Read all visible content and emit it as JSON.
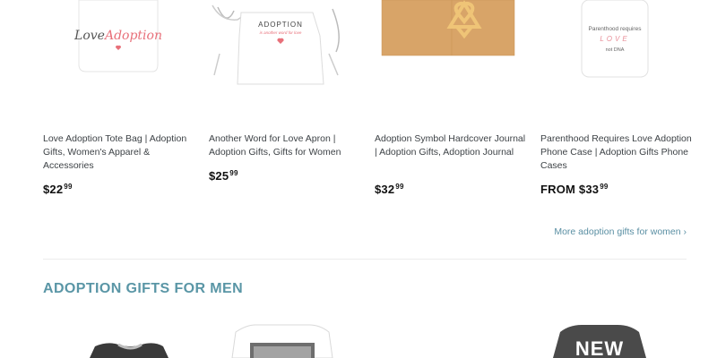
{
  "products": [
    {
      "title": "Love Adoption Tote Bag | Adoption Gifts, Women's Apparel & Accessories",
      "price_prefix": "",
      "price_main": "$22",
      "price_cents": "99",
      "image_text_1": "Love",
      "image_text_2": "Adoption"
    },
    {
      "title": "Another Word for Love Apron | Adoption Gifts, Gifts for Women",
      "price_prefix": "",
      "price_main": "$25",
      "price_cents": "99",
      "image_text_1": "ADOPTION",
      "image_text_2": "is another word for love"
    },
    {
      "title": "Adoption Symbol Hardcover Journal | Adoption Gifts, Adoption Journal",
      "price_prefix": "",
      "price_main": "$32",
      "price_cents": "99"
    },
    {
      "title": "Parenthood Requires Love Adoption Phone Case | Adoption Gifts Phone Cases",
      "price_prefix": "FROM ",
      "price_main": "$33",
      "price_cents": "99",
      "image_text_1": "Parenthood requires",
      "image_text_2": "LOVE",
      "image_text_3": "not DNA"
    }
  ],
  "more_link": "More adoption gifts for women ›",
  "section_title": "ADOPTION GIFTS FOR MEN",
  "bottom_products": [
    {
      "image_text": ""
    },
    {
      "image_text": ""
    },
    {
      "image_text": ""
    },
    {
      "image_text": "NEW"
    }
  ],
  "colors": {
    "accent": "#5a96a6",
    "link": "#5a8fa3",
    "heart": "#e8707a",
    "journal": "#d8a468"
  }
}
